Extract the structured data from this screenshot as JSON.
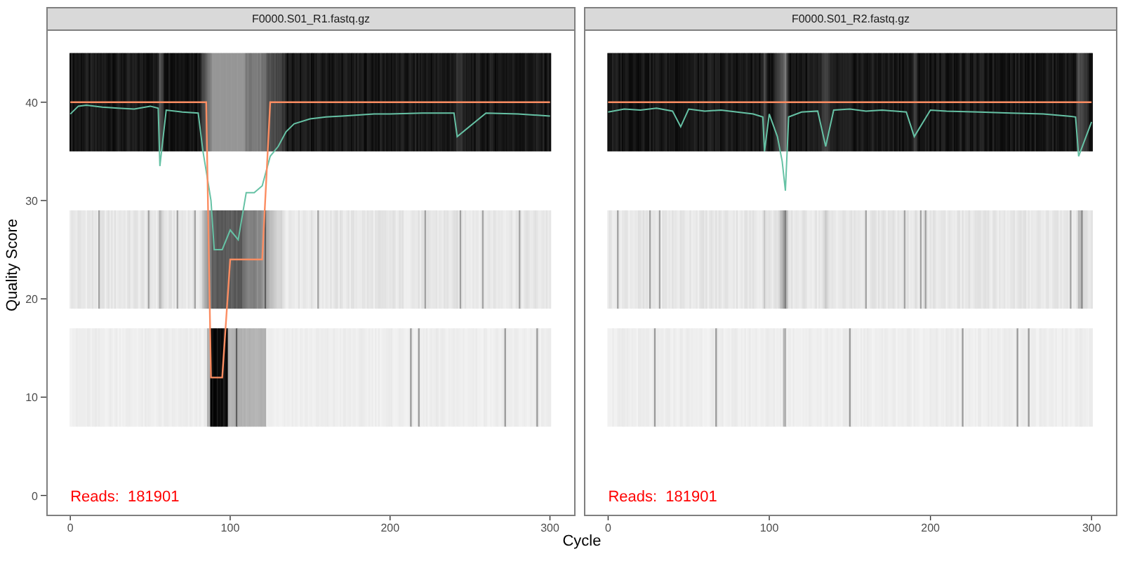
{
  "y_axis": {
    "title": "Quality Score"
  },
  "x_axis": {
    "title": "Cycle"
  },
  "panels": [
    {
      "reads": "Reads:  181901",
      "chart_data": {
        "type": "line",
        "title": "F0000.S01_R1.fastq.gz",
        "xlim": [
          -15,
          316
        ],
        "ylim": [
          -2.1,
          47.4
        ],
        "xticks": [
          0,
          100,
          200,
          300
        ],
        "yticks": [
          40,
          30,
          20,
          10,
          0
        ],
        "x": [
          0,
          5,
          10,
          20,
          30,
          40,
          50,
          55,
          56,
          60,
          70,
          80,
          83,
          85,
          88,
          90,
          95,
          100,
          105,
          110,
          115,
          120,
          125,
          130,
          135,
          140,
          150,
          160,
          170,
          180,
          190,
          200,
          220,
          240,
          242,
          260,
          280,
          300
        ],
        "series": [
          {
            "color": "#66c2a5",
            "values": [
              38.8,
              39.6,
              39.7,
              39.5,
              39.4,
              39.3,
              39.6,
              39.4,
              33.5,
              39.2,
              39.0,
              38.9,
              35,
              33,
              30,
              25,
              25,
              27,
              26,
              30.8,
              30.8,
              31.5,
              34.5,
              35.5,
              37,
              37.8,
              38.3,
              38.5,
              38.6,
              38.7,
              38.8,
              38.8,
              38.9,
              38.9,
              36.5,
              38.9,
              38.8,
              38.6
            ]
          },
          {
            "color": "#fc8d62",
            "values": [
              40,
              40,
              40,
              40,
              40,
              40,
              40,
              40,
              40,
              40,
              40,
              40,
              40,
              40,
              12,
              12,
              12,
              24,
              24,
              24,
              24,
              24,
              40,
              40,
              40,
              40,
              40,
              40,
              40,
              40,
              40,
              40,
              40,
              40,
              40,
              40,
              40,
              40
            ]
          }
        ]
      }
    },
    {
      "reads": "Reads:  181901",
      "chart_data": {
        "type": "line",
        "title": "F0000.S01_R2.fastq.gz",
        "xlim": [
          -15,
          316
        ],
        "ylim": [
          -2.1,
          47.4
        ],
        "xticks": [
          0,
          100,
          200,
          300
        ],
        "x": [
          0,
          10,
          20,
          30,
          40,
          45,
          50,
          60,
          70,
          80,
          90,
          96,
          97,
          100,
          105,
          108,
          110,
          112,
          120,
          130,
          135,
          140,
          150,
          160,
          170,
          185,
          190,
          200,
          210,
          230,
          250,
          270,
          285,
          290,
          292,
          300
        ],
        "series": [
          {
            "color": "#66c2a5",
            "values": [
              39,
              39.3,
              39.2,
              39.4,
              39.1,
              37.5,
              39.3,
              39.1,
              39.2,
              39.0,
              38.8,
              38.5,
              35,
              38.8,
              36.5,
              34,
              31,
              38.5,
              39.0,
              39.1,
              35.5,
              39.2,
              39.3,
              39.1,
              39.2,
              39.0,
              36.5,
              39.2,
              39.1,
              39.0,
              38.9,
              38.8,
              38.6,
              38.5,
              34.5,
              38.0
            ]
          },
          {
            "color": "#fc8d62",
            "values": [
              40,
              40,
              40,
              40,
              40,
              40,
              40,
              40,
              40,
              40,
              40,
              40,
              40,
              40,
              40,
              40,
              40,
              40,
              40,
              40,
              40,
              40,
              40,
              40,
              40,
              40,
              40,
              40,
              40,
              40,
              40,
              40,
              40,
              40,
              40,
              40
            ]
          }
        ]
      }
    }
  ]
}
